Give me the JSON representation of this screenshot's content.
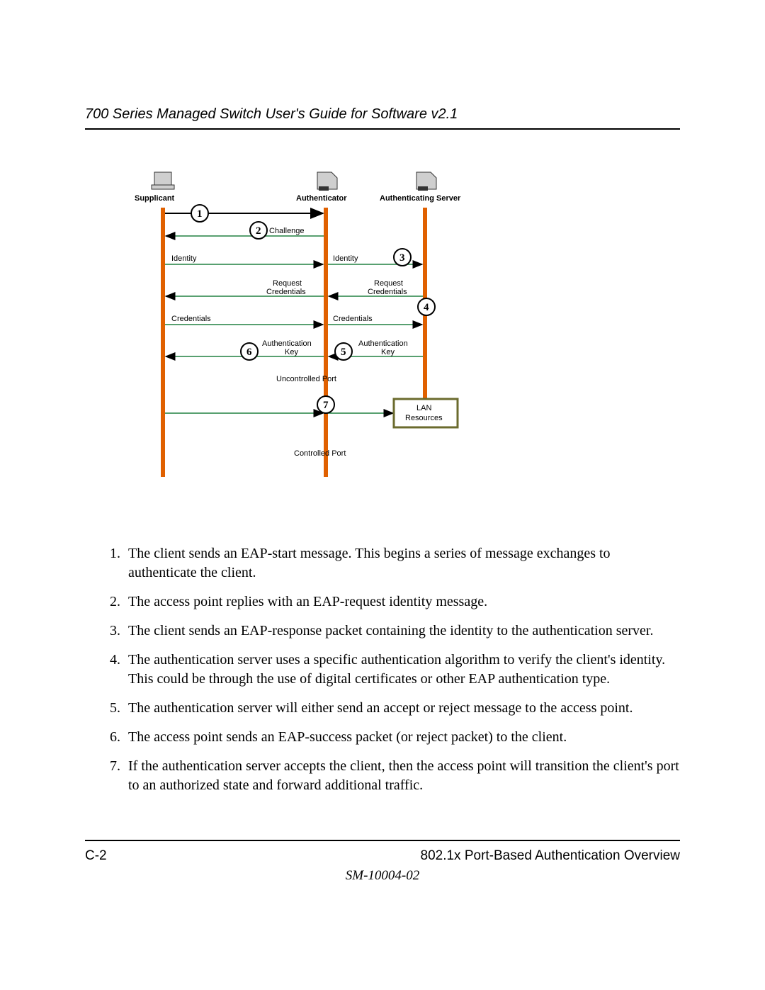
{
  "header": {
    "title": "700 Series Managed Switch User's Guide for Software v2.1"
  },
  "diagram": {
    "actors": {
      "supplicant": "Supplicant",
      "authenticator": "Authenticator",
      "auth_server": "Authenticating Server"
    },
    "labels": {
      "challenge": "Challenge",
      "identity_l": "Identity",
      "identity_r": "Identity",
      "req_cred_l_1": "Request",
      "req_cred_l_2": "Credentials",
      "req_cred_r_1": "Request",
      "req_cred_r_2": "Credentials",
      "cred_l": "Credentials",
      "cred_r": "Credentials",
      "auth_key_l_1": "Authentication",
      "auth_key_l_2": "Key",
      "auth_key_r_1": "Authentication",
      "auth_key_r_2": "Key",
      "uncontrolled": "Uncontrolled Port",
      "controlled": "Controlled Port",
      "lan_1": "LAN",
      "lan_2": "Resources"
    },
    "numbers": {
      "n1": "1",
      "n2": "2",
      "n3": "3",
      "n4": "4",
      "n5": "5",
      "n6": "6",
      "n7": "7"
    }
  },
  "steps": [
    "The client sends an EAP-start message. This begins a series of message exchanges to authenticate the client.",
    "The access point replies with an EAP-request identity message.",
    "The client sends an EAP-response packet containing the identity to the authentication server.",
    "The authentication server uses a specific authentication algorithm to verify the client's identity. This could be through the use of digital certificates or other EAP authentication type.",
    "The authentication server will either send an accept or reject message to the access point.",
    "The access point sends an EAP-success packet (or reject packet) to the client.",
    "If the authentication server accepts the client, then the access point will transition the client's port to an authorized state and forward additional traffic."
  ],
  "footer": {
    "page_num": "C-2",
    "section": "802.1x Port-Based Authentication Overview",
    "doc_id": "SM-10004-02"
  }
}
